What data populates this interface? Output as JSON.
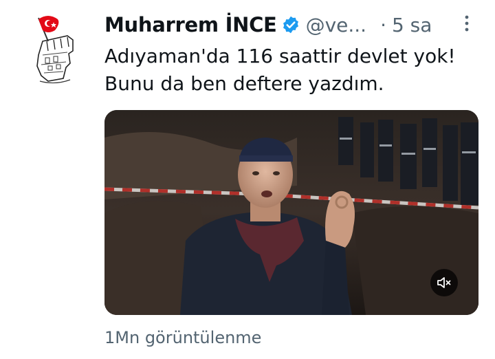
{
  "tweet": {
    "author_name": "Muharrem İNCE",
    "handle": "@ve...",
    "separator": "·",
    "time": "5 sa",
    "text_line1": "Adıyaman'da 116 saattir devlet yok!",
    "text_line2": "Bunu da ben deftere yazdım.",
    "views": "1Mn görüntülenme"
  },
  "icons": {
    "verified": "verified-badge-icon",
    "more": "more-options-icon",
    "mute": "muted-speaker-icon"
  },
  "colors": {
    "verified": "#1d9bf0",
    "secondary_text": "#536471",
    "flag": "#e30a17"
  }
}
